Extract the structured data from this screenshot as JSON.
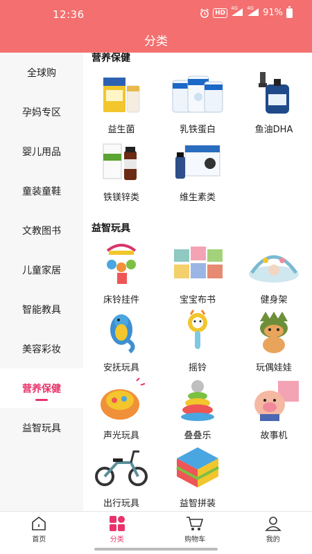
{
  "status_bar": {
    "time": "12:36",
    "hd": "HD",
    "signal1": "4G",
    "signal2": "4G",
    "battery": "91%"
  },
  "header": {
    "title": "分类"
  },
  "sidebar": {
    "items": [
      {
        "label": "全球购"
      },
      {
        "label": "孕妈专区"
      },
      {
        "label": "婴儿用品"
      },
      {
        "label": "童装童鞋"
      },
      {
        "label": "文教图书"
      },
      {
        "label": "儿童家居"
      },
      {
        "label": "智能教具"
      },
      {
        "label": "美容彩妆"
      },
      {
        "label": "营养保健",
        "active": true
      },
      {
        "label": "益智玩具"
      }
    ]
  },
  "sections": [
    {
      "title": "营养保健",
      "items": [
        {
          "label": "益生菌",
          "icon": "probiotic-box-image"
        },
        {
          "label": "乳铁蛋白",
          "icon": "lactoferrin-cans-image"
        },
        {
          "label": "鱼油DHA",
          "icon": "dha-dropper-bottle-image"
        },
        {
          "label": "铁镁锌类",
          "icon": "iron-zinc-bottle-image"
        },
        {
          "label": "维生素类",
          "icon": "vitamin-box-image"
        }
      ]
    },
    {
      "title": "益智玩具",
      "items": [
        {
          "label": "床铃挂件",
          "icon": "crib-mobile-image"
        },
        {
          "label": "宝宝布书",
          "icon": "cloth-book-image"
        },
        {
          "label": "健身架",
          "icon": "play-gym-image"
        },
        {
          "label": "安抚玩具",
          "icon": "seahorse-toy-image"
        },
        {
          "label": "摇铃",
          "icon": "rattle-image"
        },
        {
          "label": "玩偶娃娃",
          "icon": "plush-doll-image"
        },
        {
          "label": "声光玩具",
          "icon": "light-sound-toy-image"
        },
        {
          "label": "叠叠乐",
          "icon": "stacking-toy-image"
        },
        {
          "label": "故事机",
          "icon": "story-machine-image"
        },
        {
          "label": "出行玩具",
          "icon": "balance-bike-image"
        },
        {
          "label": "益智拼装",
          "icon": "building-blocks-image"
        }
      ]
    }
  ],
  "tabbar": {
    "tabs": [
      {
        "label": "首页",
        "icon": "home-icon"
      },
      {
        "label": "分类",
        "icon": "category-icon",
        "active": true
      },
      {
        "label": "购物车",
        "icon": "cart-icon"
      },
      {
        "label": "我的",
        "icon": "profile-icon"
      }
    ]
  },
  "colors": {
    "brand": "#f46f6f",
    "accent": "#e8336b"
  }
}
